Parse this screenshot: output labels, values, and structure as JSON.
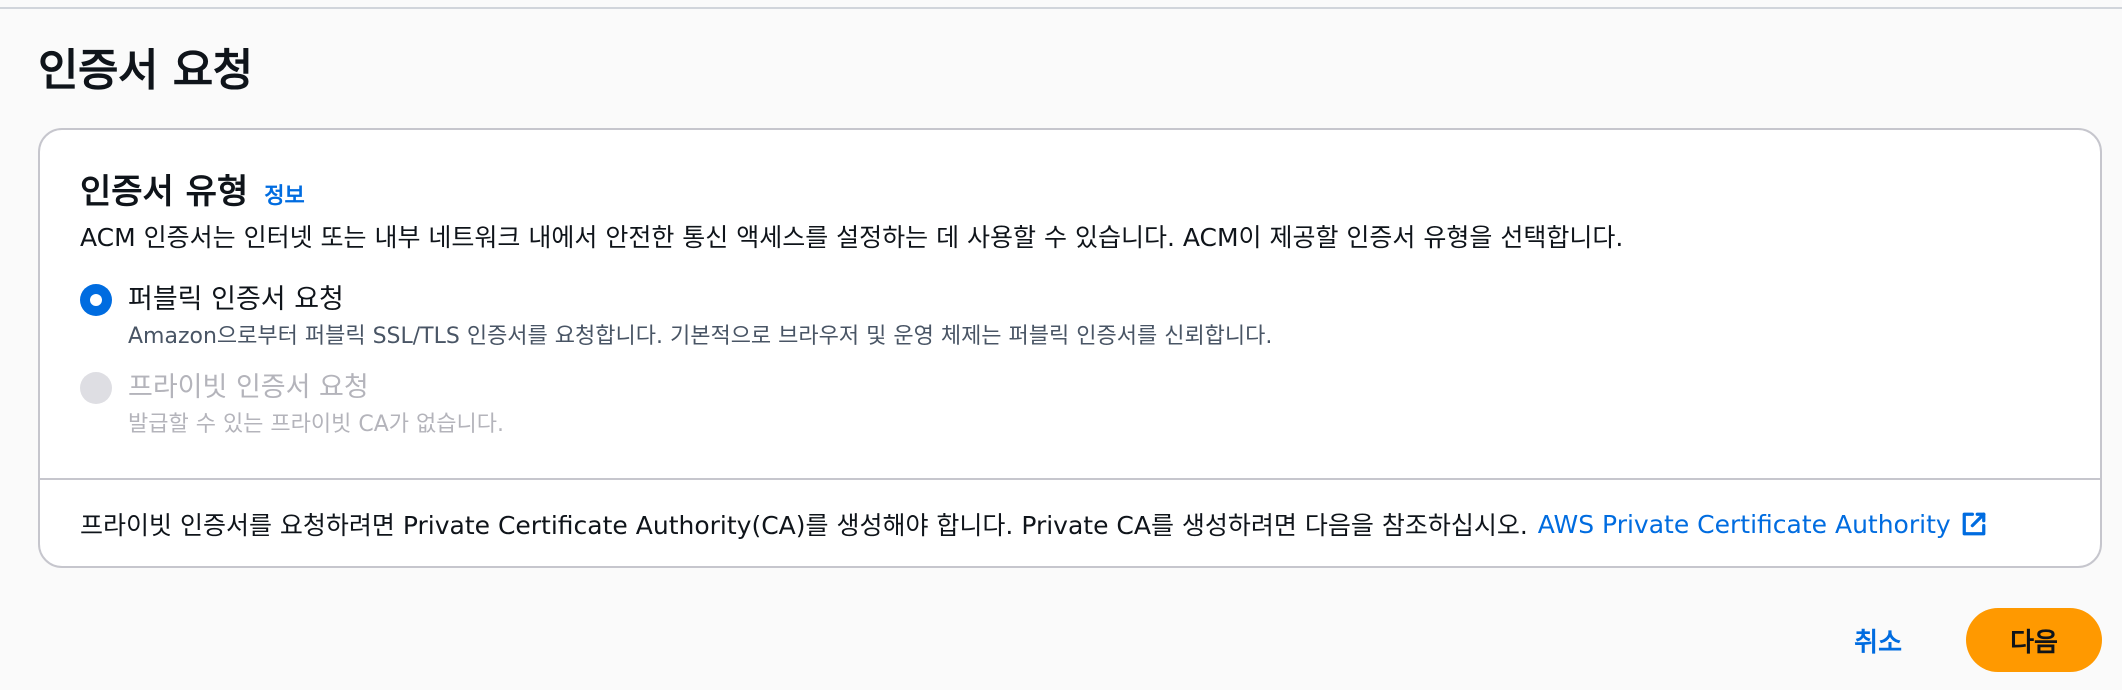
{
  "page": {
    "title": "인증서 요청"
  },
  "certificate_type": {
    "title": "인증서 유형",
    "info_link": "정보",
    "description": "ACM 인증서는 인터넷 또는 내부 네트워크 내에서 안전한 통신 액세스를 설정하는 데 사용할 수 있습니다. ACM이 제공할 인증서 유형을 선택합니다.",
    "options": [
      {
        "label": "퍼블릭 인증서 요청",
        "description": "Amazon으로부터 퍼블릭 SSL/TLS 인증서를 요청합니다. 기본적으로 브라우저 및 운영 체제는 퍼블릭 인증서를 신뢰합니다.",
        "selected": true,
        "disabled": false
      },
      {
        "label": "프라이빗 인증서 요청",
        "description": "발급할 수 있는 프라이빗 CA가 없습니다.",
        "selected": false,
        "disabled": true
      }
    ],
    "footer_text": "프라이빗 인증서를 요청하려면 Private Certificate Authority(CA)를 생성해야 합니다. Private CA를 생성하려면 다음을 참조하십시오.",
    "footer_link": "AWS Private Certificate Authority",
    "footer_link_icon": "external-link-icon"
  },
  "actions": {
    "cancel_label": "취소",
    "next_label": "다음"
  },
  "colors": {
    "accent": "#006ce0",
    "primary_button": "#ff9900"
  }
}
